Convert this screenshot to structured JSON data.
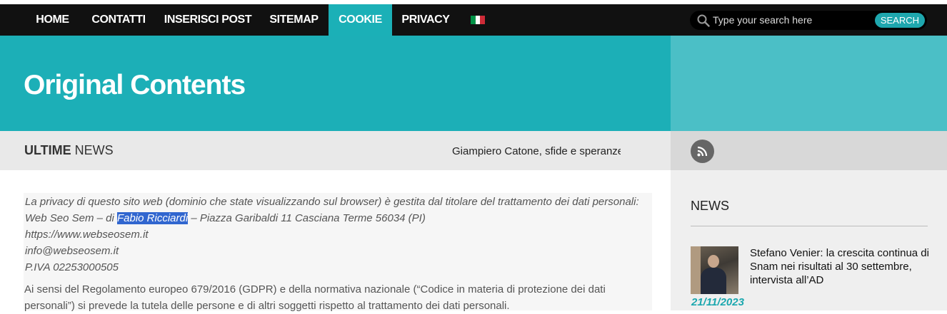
{
  "nav": {
    "items": [
      {
        "label": "HOME",
        "active": false
      },
      {
        "label": "CONTATTI",
        "active": false
      },
      {
        "label": "INSERISCI POST",
        "active": false
      },
      {
        "label": "SITEMAP",
        "active": false
      },
      {
        "label": "COOKIE",
        "active": true
      },
      {
        "label": "PRIVACY",
        "active": false
      }
    ],
    "flag_colors": [
      "#009246",
      "#ffffff",
      "#ce2b37"
    ]
  },
  "search": {
    "placeholder": "Type your search here",
    "button_label": "SEARCH"
  },
  "hero": {
    "title": "Original Contents"
  },
  "ticker": {
    "label_bold": "ULTIME",
    "label_rest": "NEWS",
    "headline": "Giampiero Catone, sfide e speranze"
  },
  "content": {
    "privacy_line1": "La privacy di questo sito web (dominio che state visualizzando sul browser) è gestita dal titolare del trattamento dei dati personali:",
    "privacy_line2_before": "Web Seo Sem – di ",
    "privacy_highlight": "Fabio Ricciardi",
    "privacy_line2_after": " – Piazza Garibaldi 11 Casciana Terme 56034 (PI)",
    "website": "https://www.webseosem.it",
    "email": "info@webseosem.it",
    "piva": "P.IVA 02253000505",
    "paragraph": "Ai sensi del Regolamento europeo 679/2016 (GDPR) e della normativa nazionale (“Codice in materia di protezione dei dati personali”) si prevede la tutela delle persone e di altri soggetti rispetto al trattamento dei dati personali."
  },
  "sidebar": {
    "title": "NEWS",
    "news": [
      {
        "headline": "Stefano Venier: la crescita continua di Snam nei risultati al 30 settembre, intervista all’AD",
        "date": "21/11/2023"
      }
    ]
  },
  "colors": {
    "accent": "#1cafb7",
    "accent_light": "#4bbfc6",
    "nav_bg": "#111111",
    "highlight": "#3166cf",
    "date": "#1aa7ae"
  },
  "icons": {
    "search": "search-icon",
    "rss": "rss-icon",
    "flag": "italy-flag-icon"
  }
}
